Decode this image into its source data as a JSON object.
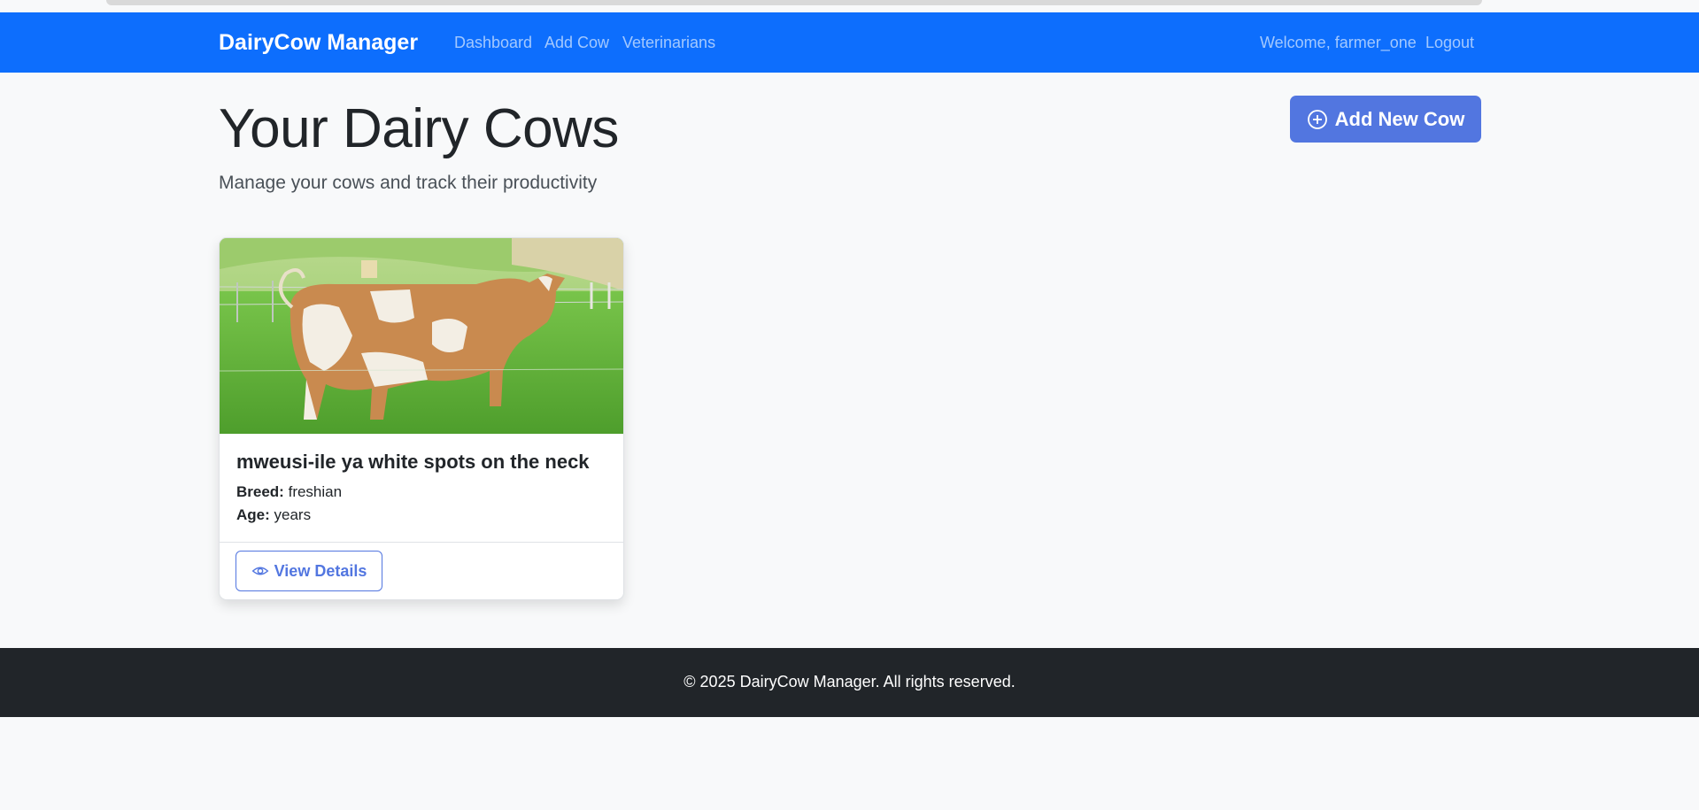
{
  "navbar": {
    "brand": "DairyCow Manager",
    "links": [
      "Dashboard",
      "Add Cow",
      "Veterinarians"
    ],
    "welcome": "Welcome, farmer_one",
    "logout": "Logout"
  },
  "header": {
    "title": "Your Dairy Cows",
    "subtitle": "Manage your cows and track their productivity",
    "add_button": "Add New Cow",
    "add_icon": "plus-circle-icon"
  },
  "cows": [
    {
      "name": "mweusi-ile ya white spots on the neck",
      "breed_label": "Breed:",
      "breed": "freshian",
      "age_label": "Age:",
      "age": "years",
      "view_button": "View Details",
      "view_icon": "eye-icon"
    }
  ],
  "footer": {
    "copyright": "© 2025 DairyCow Manager. All rights reserved."
  },
  "colors": {
    "navbar": "#0d6efd",
    "primary_button": "#5276e0",
    "footer": "#212529",
    "background": "#f8f9fa"
  }
}
